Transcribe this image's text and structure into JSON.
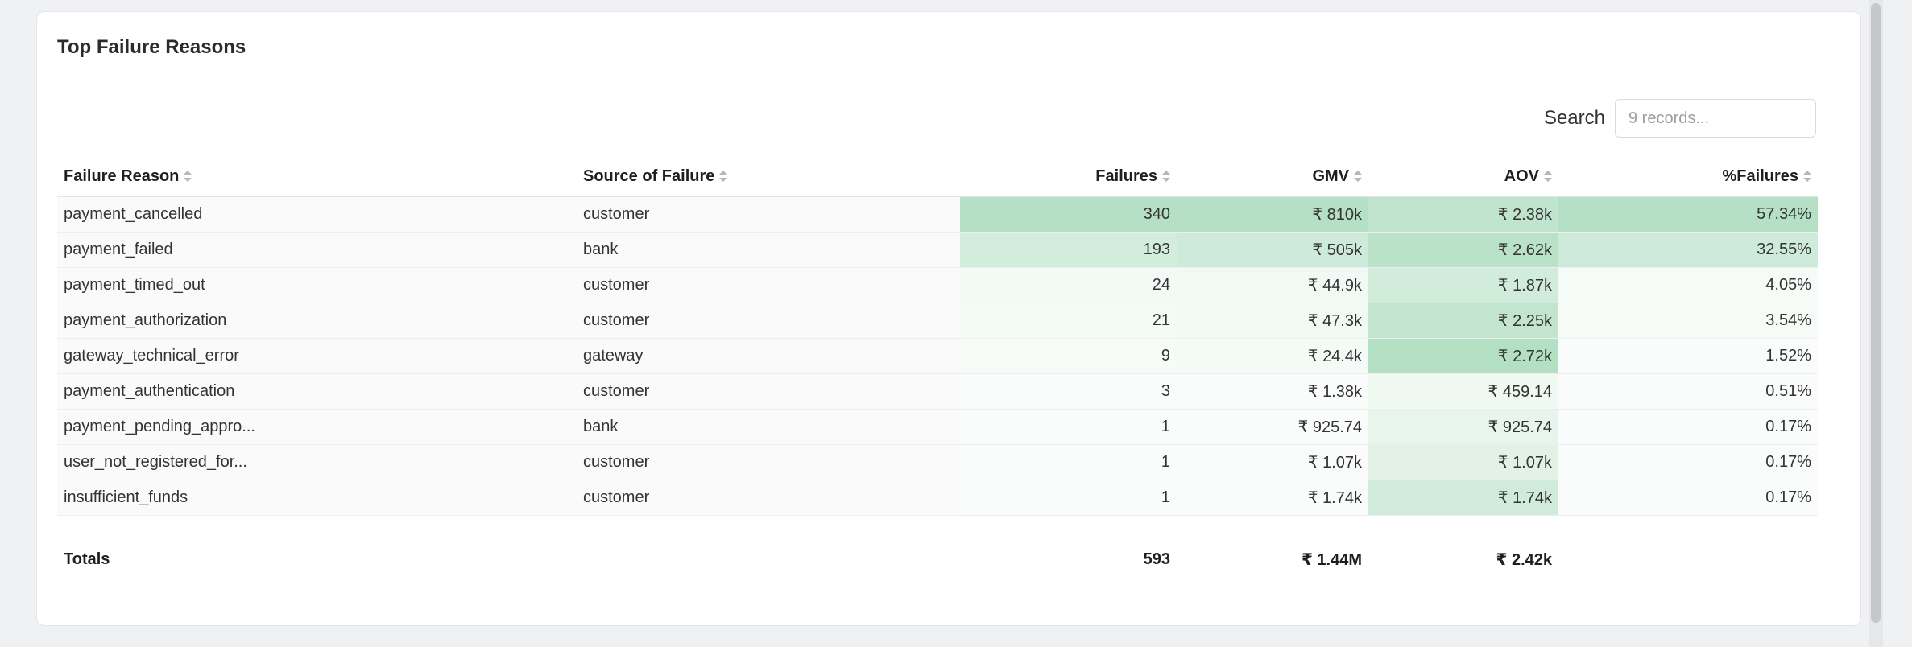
{
  "card": {
    "title": "Top Failure Reasons"
  },
  "search": {
    "label": "Search",
    "placeholder": "9 records..."
  },
  "table": {
    "columns": [
      "Failure Reason",
      "Source of Failure",
      "Failures",
      "GMV",
      "AOV",
      "%Failures"
    ],
    "rows": [
      [
        "payment_cancelled",
        "customer",
        "340",
        "₹ 810k",
        "₹ 2.38k",
        "57.34%"
      ],
      [
        "payment_failed",
        "bank",
        "193",
        "₹ 505k",
        "₹ 2.62k",
        "32.55%"
      ],
      [
        "payment_timed_out",
        "customer",
        "24",
        "₹ 44.9k",
        "₹ 1.87k",
        "4.05%"
      ],
      [
        "payment_authorization",
        "customer",
        "21",
        "₹ 47.3k",
        "₹ 2.25k",
        "3.54%"
      ],
      [
        "gateway_technical_error",
        "gateway",
        "9",
        "₹ 24.4k",
        "₹ 2.72k",
        "1.52%"
      ],
      [
        "payment_authentication",
        "customer",
        "3",
        "₹ 1.38k",
        "₹ 459.14",
        "0.51%"
      ],
      [
        "payment_pending_appro...",
        "bank",
        "1",
        "₹ 925.74",
        "₹ 925.74",
        "0.17%"
      ],
      [
        "user_not_registered_for...",
        "customer",
        "1",
        "₹ 1.07k",
        "₹ 1.07k",
        "0.17%"
      ],
      [
        "insufficient_funds",
        "customer",
        "1",
        "₹ 1.74k",
        "₹ 1.74k",
        "0.17%"
      ]
    ],
    "heat": [
      [
        "#b5e0c5",
        "#b5e0c5",
        "#c0e4cd",
        "#b5e0c5"
      ],
      [
        "#d3eddc",
        "#cdeada",
        "#b9e2c9",
        "#cdeada"
      ],
      [
        "#f3faf5",
        "#f1f9f4",
        "#d1ecda",
        "#f6fbf7"
      ],
      [
        "#f4faf6",
        "#f1f9f4",
        "#c3e5cf",
        "#f6fbf7"
      ],
      [
        "#f6fbf7",
        "#f4faf6",
        "#b3dfc3",
        "#f9fcfa"
      ],
      [
        "#f9fcfa",
        "#f9fcfa",
        "#f0f8f2",
        "#fafcfb"
      ],
      [
        "#fafcfb",
        "#fafcfb",
        "#e8f5ec",
        "#fafcfb"
      ],
      [
        "#fafcfb",
        "#fafcfb",
        "#e2f2e7",
        "#fafcfb"
      ],
      [
        "#fafcfb",
        "#fafcfb",
        "#d0ebd9",
        "#fafcfb"
      ]
    ],
    "totals": [
      "Totals",
      "",
      "593",
      "₹ 1.44M",
      "₹ 2.42k",
      ""
    ]
  }
}
